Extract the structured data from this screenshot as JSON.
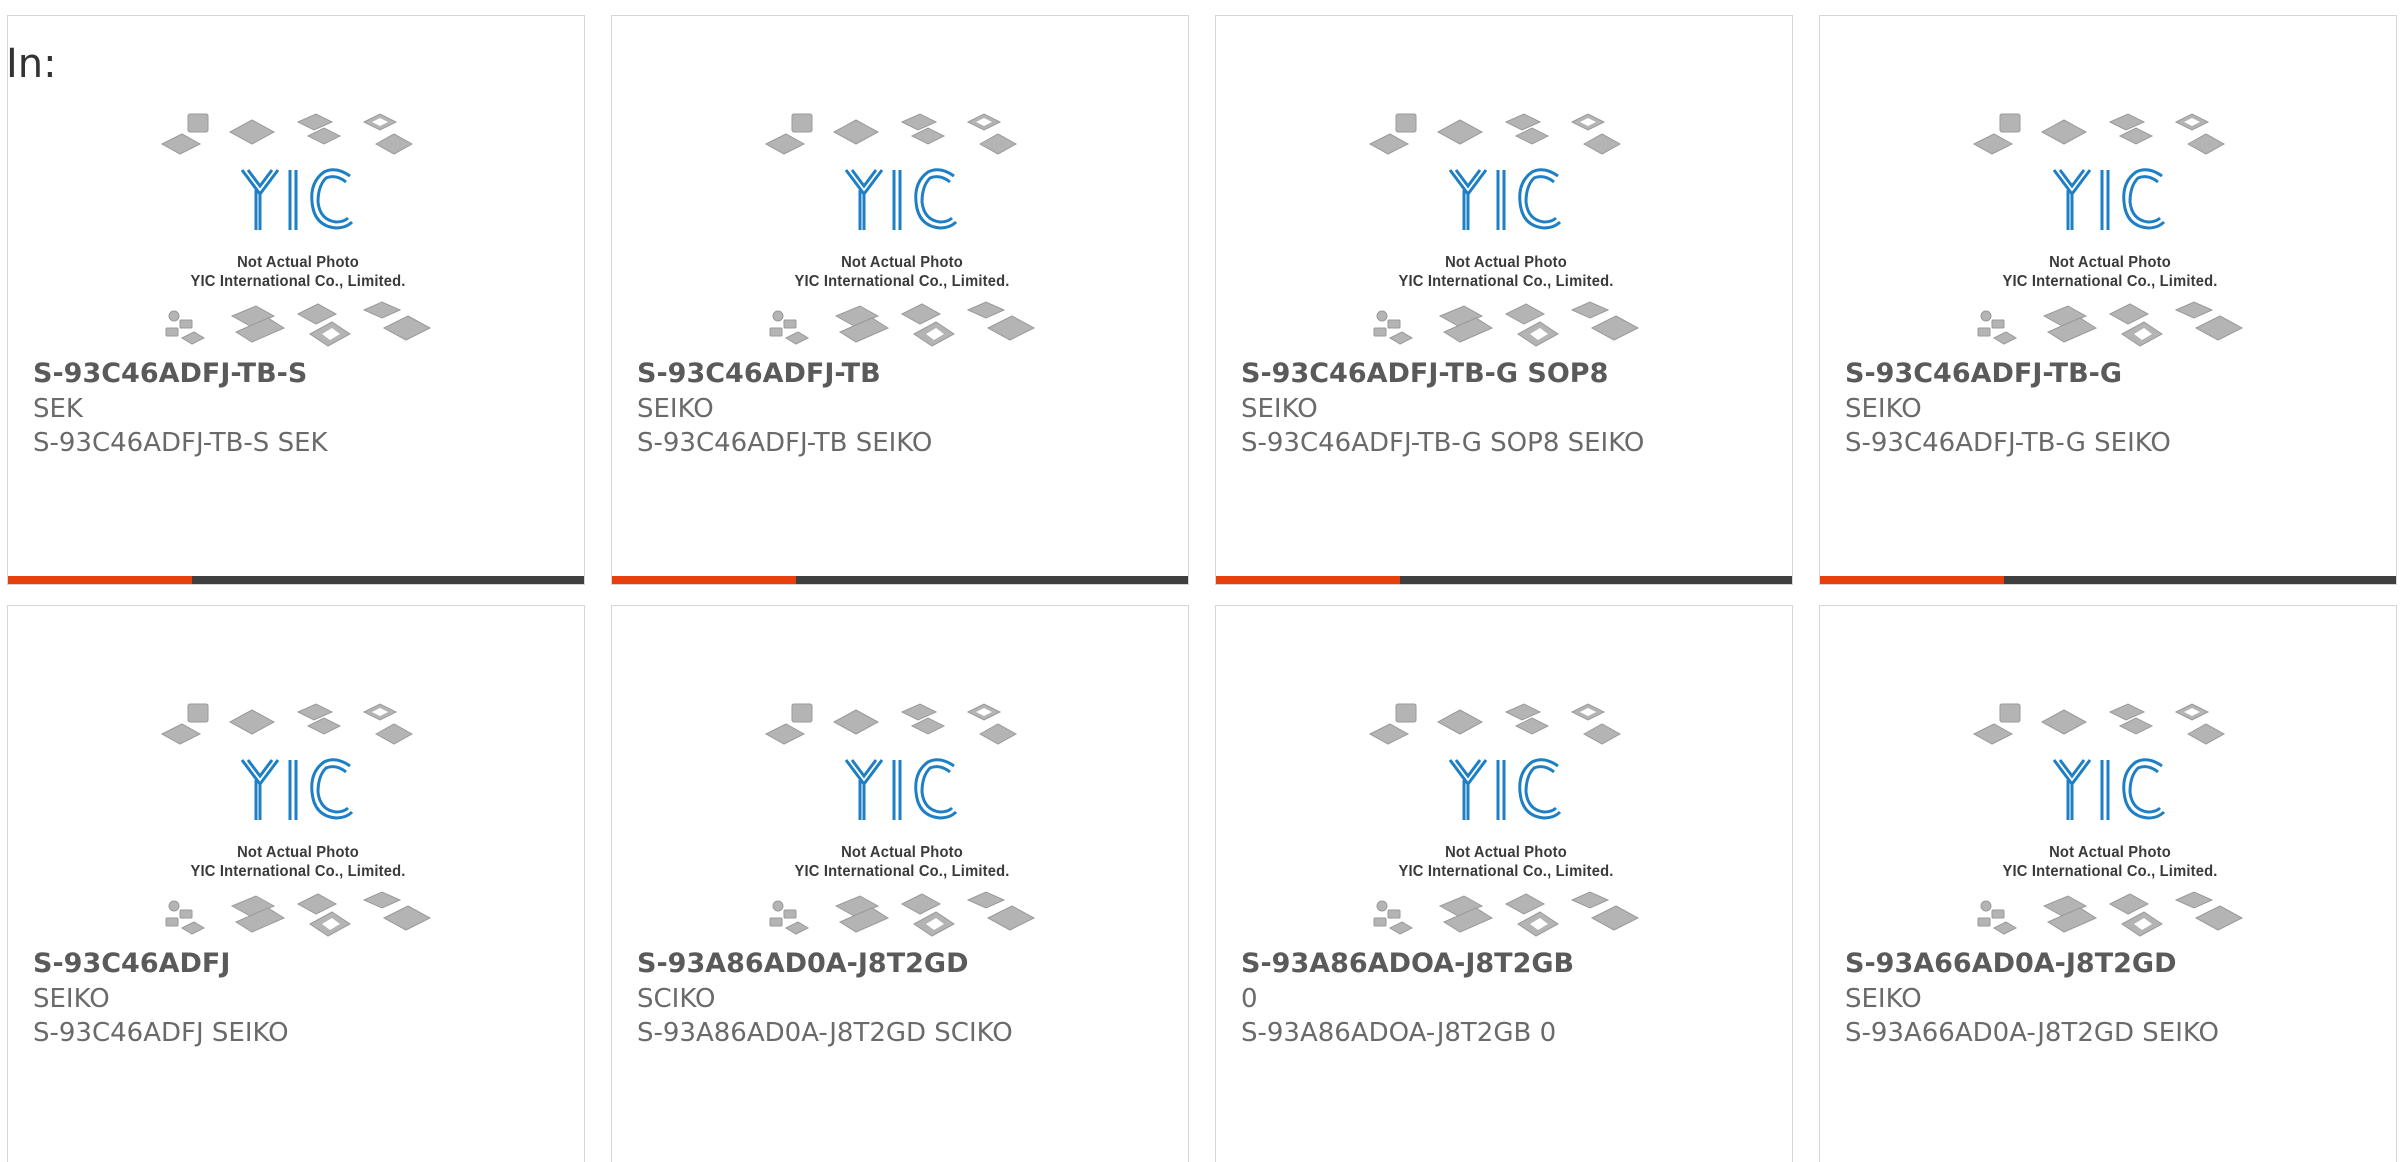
{
  "header": {
    "label": "In:"
  },
  "placeholder": {
    "line1": "Not Actual Photo",
    "line2": "YIC International Co., Limited.",
    "logo_text": "YIC"
  },
  "colors": {
    "accent": "#e8400c",
    "bar_track": "#3f3f3f",
    "logo_blue": "#1e7fc4",
    "chip_gray": "#b4b4b4"
  },
  "products": [
    {
      "part": "S-93C46ADFJ-TB-S",
      "maker": "SEK",
      "desc": "S-93C46ADFJ-TB-S SEK",
      "progress": 0.32
    },
    {
      "part": "S-93C46ADFJ-TB",
      "maker": "SEIKO",
      "desc": "S-93C46ADFJ-TB SEIKO",
      "progress": 0.32
    },
    {
      "part": "S-93C46ADFJ-TB-G SOP8",
      "maker": "SEIKO",
      "desc": "S-93C46ADFJ-TB-G SOP8 SEIKO",
      "progress": 0.32
    },
    {
      "part": "S-93C46ADFJ-TB-G",
      "maker": "SEIKO",
      "desc": "S-93C46ADFJ-TB-G SEIKO",
      "progress": 0.32
    },
    {
      "part": "S-93C46ADFJ",
      "maker": "SEIKO",
      "desc": "S-93C46ADFJ SEIKO"
    },
    {
      "part": "S-93A86AD0A-J8T2GD",
      "maker": "SCIKO",
      "desc": "S-93A86AD0A-J8T2GD SCIKO"
    },
    {
      "part": "S-93A86ADOA-J8T2GB",
      "maker": "0",
      "desc": "S-93A86ADOA-J8T2GB 0"
    },
    {
      "part": "S-93A66AD0A-J8T2GD",
      "maker": "SEIKO",
      "desc": "S-93A66AD0A-J8T2GD SEIKO"
    }
  ]
}
